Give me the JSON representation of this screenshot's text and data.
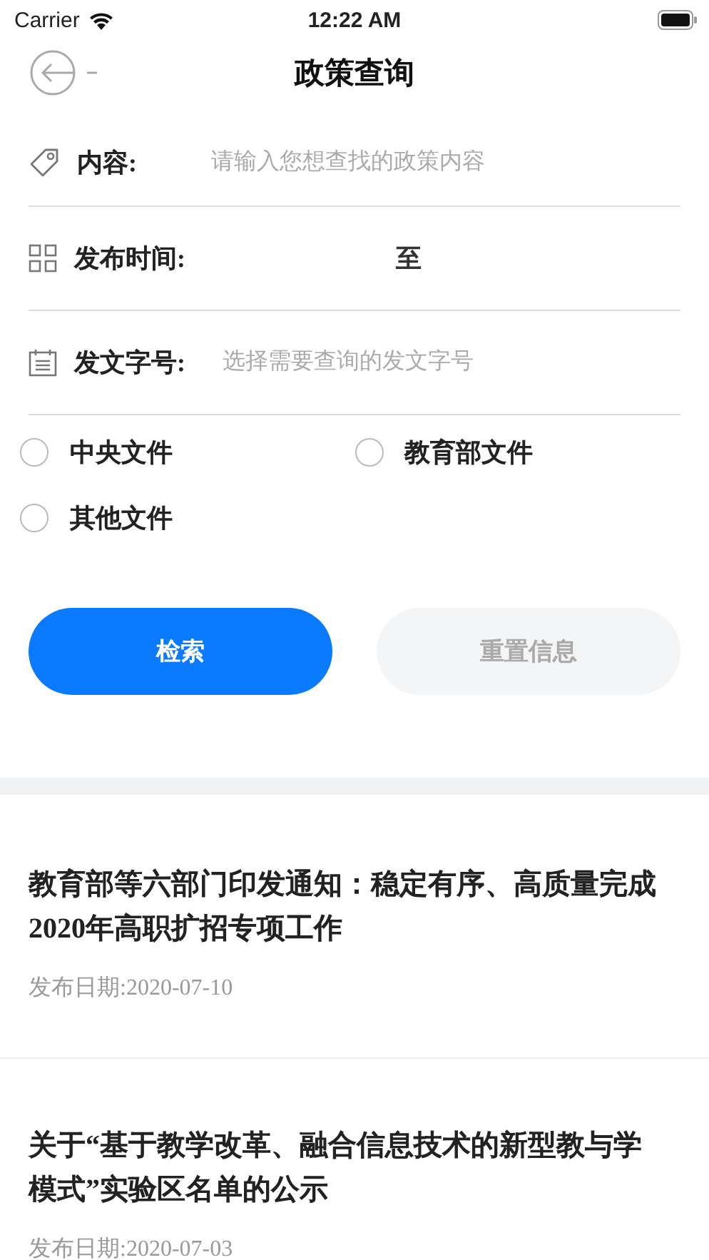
{
  "status_bar": {
    "carrier": "Carrier",
    "time": "12:22 AM"
  },
  "nav": {
    "title": "政策查询"
  },
  "fields": [
    {
      "kind": "text",
      "label": "内容:",
      "placeholder": "请输入您想查找的政策内容"
    },
    {
      "kind": "range",
      "label": "发布时间:",
      "separator": "至"
    },
    {
      "kind": "select",
      "label": "发文字号:",
      "placeholder": "选择需要查询的发文字号"
    }
  ],
  "options": [
    {
      "label": "中央文件",
      "selected": false
    },
    {
      "label": "教育部文件",
      "selected": false
    },
    {
      "label": "其他文件",
      "selected": false
    }
  ],
  "buttons": [
    {
      "label": "检索",
      "kind": "primary"
    },
    {
      "label": "重置信息",
      "kind": "secondary"
    }
  ],
  "articles": [
    {
      "title": "教育部等六部门印发通知：稳定有序、高质量完成2020年高职扩招专项工作",
      "date": "发布日期:2020-07-10"
    },
    {
      "title": "关于“基于教学改革、融合信息技术的新型教与学模式”实验区名单的公示",
      "date": "发布日期:2020-07-03"
    }
  ]
}
